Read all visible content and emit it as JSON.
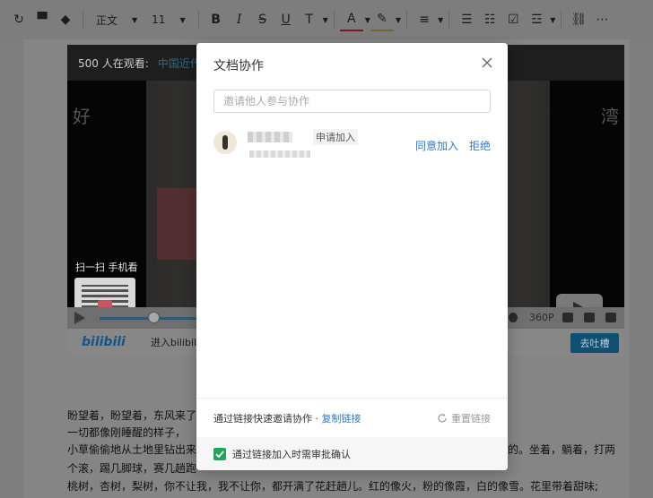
{
  "toolbar": {
    "items": [
      {
        "name": "redo-icon",
        "glyph": "↻"
      },
      {
        "name": "format-painter-icon",
        "glyph": "🖌"
      },
      {
        "name": "clear-format-icon",
        "glyph": "⌫"
      }
    ],
    "style_select": "正文",
    "size_select": "11",
    "bold": "B",
    "italic": "I",
    "strike": "S",
    "underline": "U",
    "superscript": "T",
    "font_color": "A"
  },
  "video": {
    "viewers": "500 人在观看:",
    "title": "中国近代",
    "side_left": "好",
    "side_right": "湾",
    "scan_label": "扫一扫 手机看",
    "resolution": "360P",
    "brand": "bilibili",
    "bottom_text": "进入bilibili,一起",
    "comment_button": "去吐槽"
  },
  "paragraphs": [
    "盼望着，盼望着，东风来了",
    "一切都像刚睡醒的样子，",
    "小草偷偷地从土地里钻出来",
    "个滚，踢几脚球，赛几趟跑",
    "桃树，杏树，梨树，你不让我，我不让你，都开满了花赶趟儿。红的像火，粉的像霞，白的像雪。花里带着甜味;"
  ],
  "para_right": [
    "的。坐着，躺着，打两"
  ],
  "modal": {
    "title": "文档协作",
    "invite_placeholder": "邀请他人参与协作",
    "request": {
      "status": "申请加入",
      "accept": "同意加入",
      "reject": "拒绝"
    },
    "link_text": "通过链接快速邀请协作 · ",
    "copy_link": "复制链接",
    "reset_link": "重置链接",
    "approval_label": "通过链接加入时需审批确认",
    "approval_checked": true
  },
  "colors": {
    "accent": "#2c7bd2",
    "check": "#1fa65a"
  }
}
